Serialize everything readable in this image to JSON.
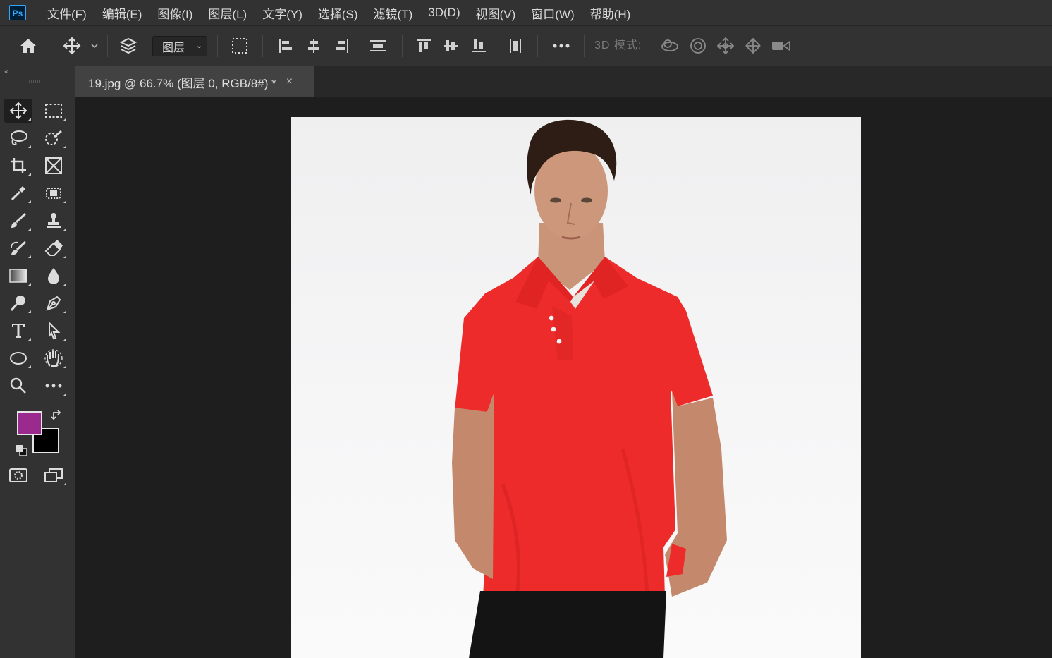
{
  "app": {
    "logo": "Ps"
  },
  "menu": [
    "文件(F)",
    "编辑(E)",
    "图像(I)",
    "图层(L)",
    "文字(Y)",
    "选择(S)",
    "滤镜(T)",
    "3D(D)",
    "视图(V)",
    "窗口(W)",
    "帮助(H)"
  ],
  "options": {
    "auto_select_value": "图层",
    "mode_label": "3D 模式:"
  },
  "tools": [
    {
      "name": "move-tool",
      "icon": "move-icon"
    },
    {
      "name": "marquee-tool",
      "icon": "rect-marquee-icon"
    },
    {
      "name": "lasso-tool",
      "icon": "lasso-icon"
    },
    {
      "name": "quick-select-tool",
      "icon": "quick-select-icon"
    },
    {
      "name": "crop-tool",
      "icon": "crop-icon"
    },
    {
      "name": "frame-tool",
      "icon": "frame-icon"
    },
    {
      "name": "eyedropper-tool",
      "icon": "eyedropper-icon"
    },
    {
      "name": "healing-tool",
      "icon": "spot-healing-icon"
    },
    {
      "name": "brush-tool",
      "icon": "brush-icon"
    },
    {
      "name": "stamp-tool",
      "icon": "clone-stamp-icon"
    },
    {
      "name": "history-brush-tool",
      "icon": "history-brush-icon"
    },
    {
      "name": "eraser-tool",
      "icon": "eraser-icon"
    },
    {
      "name": "gradient-tool",
      "icon": "gradient-icon"
    },
    {
      "name": "blur-tool",
      "icon": "blur-drop-icon"
    },
    {
      "name": "dodge-tool",
      "icon": "dodge-icon"
    },
    {
      "name": "pen-tool",
      "icon": "pen-icon"
    },
    {
      "name": "type-tool",
      "icon": "type-icon"
    },
    {
      "name": "path-select-tool",
      "icon": "arrow-select-icon"
    },
    {
      "name": "ellipse-tool",
      "icon": "ellipse-icon"
    },
    {
      "name": "hand-tool",
      "icon": "hand-icon"
    },
    {
      "name": "zoom-tool",
      "icon": "zoom-icon"
    },
    {
      "name": "more-tools",
      "icon": "ellipsis-icon"
    }
  ],
  "colors": {
    "foreground": "#9b2a8f",
    "background": "#000000",
    "accent": "#31a8ff"
  },
  "document": {
    "title": "19.jpg @ 66.7% (图层 0, RGB/8#) *",
    "close_glyph": "×"
  },
  "image": {
    "subject": "man in red polo shirt",
    "shirt_color": "#ee2b2b",
    "backdrop_color": "#f3f3f4"
  }
}
